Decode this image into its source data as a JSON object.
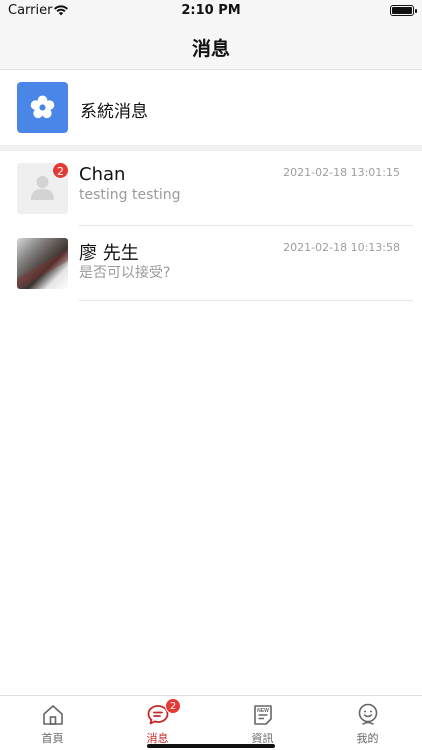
{
  "status_bar": {
    "carrier": "Carrier",
    "time": "2:10 PM",
    "icons": [
      "wifi-icon",
      "battery-icon"
    ]
  },
  "nav": {
    "title": "消息"
  },
  "system_message": {
    "label": "系統消息",
    "icon": "settings-flower-icon",
    "icon_color": "#4a86e8"
  },
  "conversations": [
    {
      "name": "Chan",
      "preview": "testing testing",
      "time": "2021-02-18 13:01:15",
      "unread": "2",
      "avatar": "default-user-avatar"
    },
    {
      "name": "廖 先生",
      "preview": "是否可以接受?",
      "time": "2021-02-18 10:13:58",
      "avatar": "photo-avatar"
    }
  ],
  "tabs": [
    {
      "label": "首頁",
      "icon": "home-icon"
    },
    {
      "label": "消息",
      "icon": "chat-icon",
      "badge": "2",
      "active": true
    },
    {
      "label": "資訊",
      "icon": "news-icon",
      "icon_text": "NEW"
    },
    {
      "label": "我的",
      "icon": "profile-icon"
    }
  ],
  "colors": {
    "accent": "#c62828",
    "badge": "#e53935",
    "system_icon_bg": "#4a86e8"
  }
}
